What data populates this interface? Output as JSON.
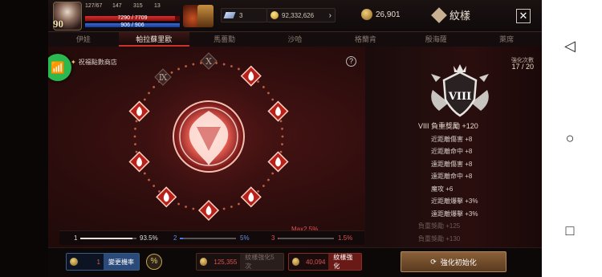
{
  "player": {
    "level": "90",
    "stat_a": "127/67",
    "stat_b": "147",
    "stat_c": "315",
    "stat_d": "13",
    "hp_text": "7290 / 7709",
    "hp_fraction": 0.946,
    "mp_text": "906 / 906",
    "mp_fraction": 1.0
  },
  "currency": {
    "item_count": "1",
    "diamond": "3",
    "gold": "92,332,626",
    "crest_points": "26,901"
  },
  "header": {
    "title": "紋樣"
  },
  "tabs": [
    {
      "label": "伊娃",
      "active": false
    },
    {
      "label": "帕拉蘇里歐",
      "active": true
    },
    {
      "label": "馬薔勳",
      "active": false
    },
    {
      "label": "沙哈",
      "active": false
    },
    {
      "label": "格蘭肯",
      "active": false
    },
    {
      "label": "殷海薩",
      "active": false
    },
    {
      "label": "萊席",
      "active": false
    }
  ],
  "shop": {
    "label": "祝福點數商店"
  },
  "ring": {
    "numeral_ix": "Ⅸ",
    "numeral_x": "Ⅹ",
    "active_nodes": 8
  },
  "probability": {
    "label1": "1",
    "value1": "93.5%",
    "fraction1": 0.935,
    "label2": "2",
    "value2": "5%",
    "fraction2": 0.05,
    "label3": "3",
    "value3": "1.5%",
    "fraction3": 0.015,
    "max_label": "Max2.5%"
  },
  "upgrade": {
    "count_label": "強化次數",
    "count_value": "17 / 20",
    "badge_numeral": "VIII"
  },
  "stats": [
    {
      "text": "VIII 負重獎勵 +120",
      "kind": "head"
    },
    {
      "text": "近距離傷害 +8",
      "kind": "sub"
    },
    {
      "text": "近距離命中 +8",
      "kind": "sub"
    },
    {
      "text": "遠距離傷害 +8",
      "kind": "sub"
    },
    {
      "text": "遠距離命中 +8",
      "kind": "sub"
    },
    {
      "text": "魔攻 +6",
      "kind": "sub"
    },
    {
      "text": "近距離爆擊 +3%",
      "kind": "sub"
    },
    {
      "text": "遠距離爆擊 +3%",
      "kind": "sub"
    },
    {
      "text": "負重獎勵 +125",
      "kind": "dim"
    },
    {
      "text": "負重獎勵 +130",
      "kind": "dim"
    }
  ],
  "bottom": {
    "change_cost": "1",
    "change_label": "變更機率",
    "pct_icon": "%",
    "cost1": "125,355",
    "btn1_label": "紋樣強化5次",
    "cost2": "40,094",
    "btn2_label": "紋樣強化",
    "reset_label": "強化初始化"
  },
  "colors": {
    "accent": "#c8342a",
    "hp": "#d23030",
    "mp": "#3a6ad8",
    "wifi": "#2bb84e"
  }
}
